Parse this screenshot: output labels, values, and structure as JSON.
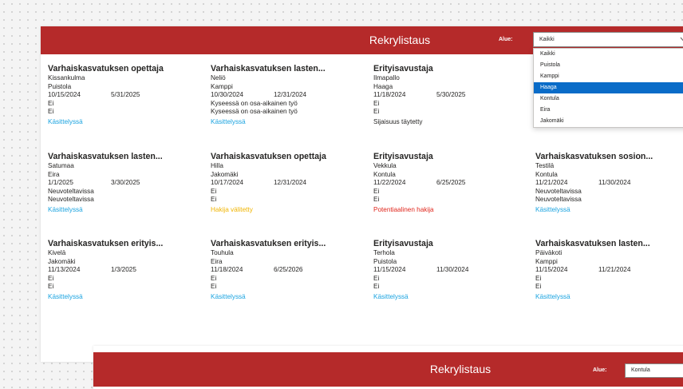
{
  "header": {
    "title": "Rekrylistaus",
    "filter_label": "Alue:",
    "filter_value": "Kaikki"
  },
  "dropdown": {
    "options": [
      "Kaikki",
      "Puistola",
      "Kamppi",
      "Haaga",
      "Kontula",
      "Eira",
      "Jakomäki"
    ],
    "selected": "Haaga"
  },
  "jobs": [
    {
      "title": "Varhaiskasvatuksen opettaja",
      "unit": "Kissankulma",
      "area": "Puistola",
      "start": "10/15/2024",
      "end": "5/31/2025",
      "line1": "Ei",
      "line2": "Ei",
      "status": "Käsittelyssä",
      "status_color": "#1aa3e0"
    },
    {
      "title": "Varhaiskasvatuksen lasten...",
      "unit": "Neliö",
      "area": "Kamppi",
      "start": "10/30/2024",
      "end": "12/31/2024",
      "line1": "Kyseessä on osa-aikainen työ",
      "line2": "Kyseessä on osa-aikainen työ",
      "status": "Käsittelyssä",
      "status_color": "#1aa3e0"
    },
    {
      "title": "Erityisavustaja",
      "unit": "Ilmapallo",
      "area": "Haaga",
      "start": "11/18/2024",
      "end": "5/30/2025",
      "line1": "Ei",
      "line2": "Ei",
      "status": "Sijaisuus täytetty",
      "status_color": "#252423"
    },
    {
      "title": "Varhaiskasvatuksen lasten...",
      "unit": "Satumaa",
      "area": "Eira",
      "start": "1/1/2025",
      "end": "3/30/2025",
      "line1": "Neuvoteltavissa",
      "line2": "Neuvoteltavissa",
      "status": "Käsittelyssä",
      "status_color": "#1aa3e0"
    },
    {
      "title": "Varhaiskasvatuksen opettaja",
      "unit": "Hilla",
      "area": "Jakomäki",
      "start": "10/17/2024",
      "end": "12/31/2024",
      "line1": "Ei",
      "line2": "Ei",
      "status": "Hakija välitetty",
      "status_color": "#f0b400"
    },
    {
      "title": "Erityisavustaja",
      "unit": "Vekkula",
      "area": "Kontula",
      "start": "11/22/2024",
      "end": "6/25/2025",
      "line1": "Ei",
      "line2": "Ei",
      "status": "Potentiaalinen hakija",
      "status_color": "#e0251b"
    },
    {
      "title": "Varhaiskasvatuksen sosion...",
      "unit": "Testilä",
      "area": "Kontula",
      "start": "11/21/2024",
      "end": "11/30/2024",
      "line1": "Neuvoteltavissa",
      "line2": "Neuvoteltavissa",
      "status": "Käsittelyssä",
      "status_color": "#1aa3e0"
    },
    {
      "title": "Varhaiskasvatuksen erityis...",
      "unit": "Kivelä",
      "area": "Jakomäki",
      "start": "11/13/2024",
      "end": "1/3/2025",
      "line1": "Ei",
      "line2": "Ei",
      "status": "Käsittelyssä",
      "status_color": "#1aa3e0"
    },
    {
      "title": "Varhaiskasvatuksen erityis...",
      "unit": "Touhula",
      "area": "Eira",
      "start": "11/18/2024",
      "end": "6/25/2026",
      "line1": "Ei",
      "line2": "Ei",
      "status": "Käsittelyssä",
      "status_color": "#1aa3e0"
    },
    {
      "title": "Erityisavustaja",
      "unit": "Terhola",
      "area": "Puistola",
      "start": "11/15/2024",
      "end": "11/30/2024",
      "line1": "Ei",
      "line2": "Ei",
      "status": "Käsittelyssä",
      "status_color": "#1aa3e0"
    },
    {
      "title": "Varhaiskasvatuksen lasten...",
      "unit": "Päiväkoti",
      "area": "Kamppi",
      "start": "11/15/2024",
      "end": "11/21/2024",
      "line1": "Ei",
      "line2": "Ei",
      "status": "Käsittelyssä",
      "status_color": "#1aa3e0"
    }
  ],
  "second_panel": {
    "title": "Rekrylistaus",
    "filter_label": "Alue:",
    "filter_value": "Kontula"
  },
  "colors": {
    "header": "#b52a2a",
    "selected": "#0a6cc8"
  }
}
